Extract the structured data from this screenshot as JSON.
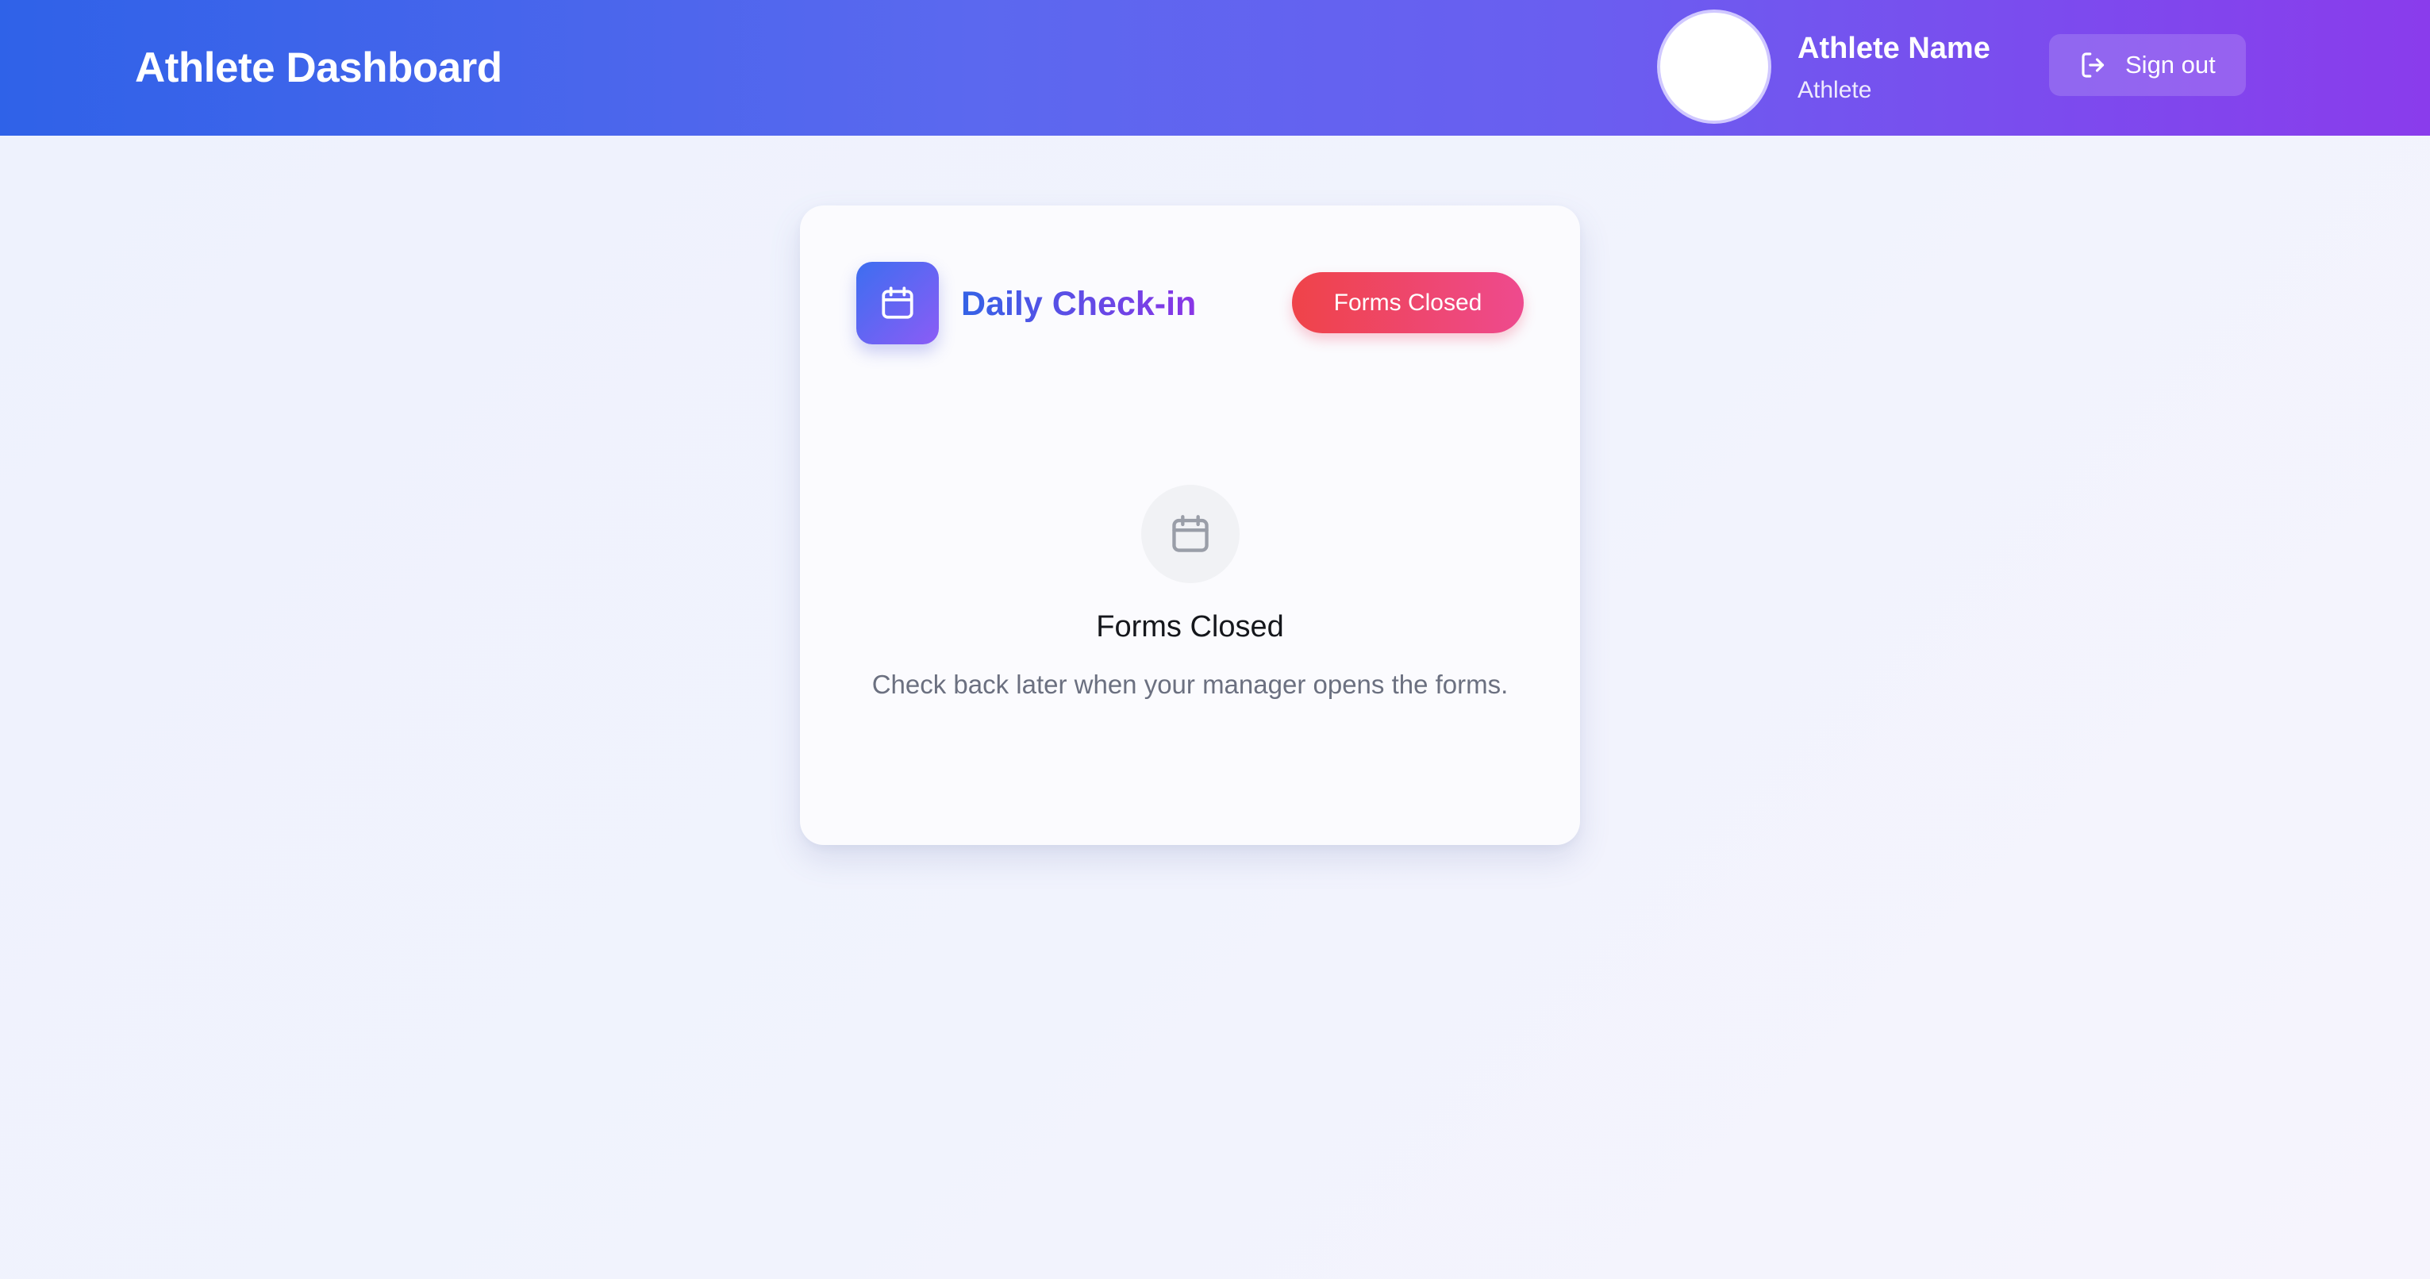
{
  "header": {
    "title": "Athlete Dashboard",
    "user_name": "Athlete Name",
    "user_role": "Athlete",
    "signout_label": "Sign out",
    "signout_icon": "sign-out-icon"
  },
  "card": {
    "title": "Daily Check-in",
    "icon": "calendar-icon",
    "status_badge": "Forms Closed",
    "empty_state": {
      "icon": "calendar-icon",
      "title": "Forms Closed",
      "message": "Check back later when your manager opens the forms."
    }
  },
  "colors": {
    "header_gradient_start": "#2f62e8",
    "header_gradient_end": "#8a3cec",
    "badge_start": "#ef4349",
    "badge_end": "#ee4a8e",
    "title_gradient_start": "#3463e6",
    "title_gradient_end": "#8a35e6"
  }
}
